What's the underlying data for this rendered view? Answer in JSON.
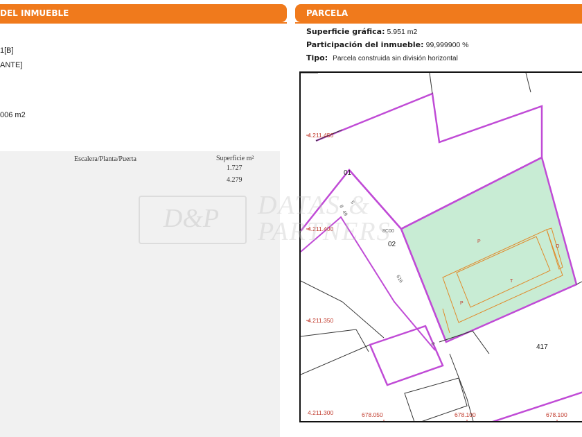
{
  "left_panel": {
    "header_title": "DEL INMUEBLE",
    "fragments": [
      "1[B]",
      "ANTE]",
      "006 m2"
    ],
    "table": {
      "col_escalera": "Escalera/Planta/Puerta",
      "col_superficie": "Superficie m²",
      "rows": [
        {
          "superficie": "1.727"
        },
        {
          "superficie": "4.279"
        }
      ]
    }
  },
  "right_panel": {
    "header_title": "PARCELA",
    "superficie_label": "Superficie gráfica:",
    "superficie_value": "5.951 m2",
    "participacion_label": "Participación del inmueble:",
    "participacion_value": "99,999900 %",
    "tipo_label": "Tipo:",
    "tipo_value": "Parcela construida sin división horizontal"
  },
  "map": {
    "y_coords": [
      "4.211.450",
      "4.211.400",
      "4.211.350",
      "4.211.300"
    ],
    "x_coords": [
      "678.050",
      "678.100",
      "678.100"
    ],
    "parcel_labels": [
      "01",
      "02",
      "417"
    ],
    "building_letters": [
      "P",
      "T",
      "P",
      "O"
    ],
    "edge_labels": [
      "5",
      "8",
      "49",
      "616",
      "8C00",
      "8"
    ],
    "colors": {
      "parcel_fill": "#c8ecd4",
      "boundary": "#c04bd6",
      "coord_text": "#c0392b"
    }
  },
  "watermark": {
    "logo": "D&P",
    "line1": "DATAS &",
    "line2": "PARTNERS"
  },
  "colors": {
    "header_orange": "#f07a1c",
    "table_bg": "#f1f1f1"
  }
}
